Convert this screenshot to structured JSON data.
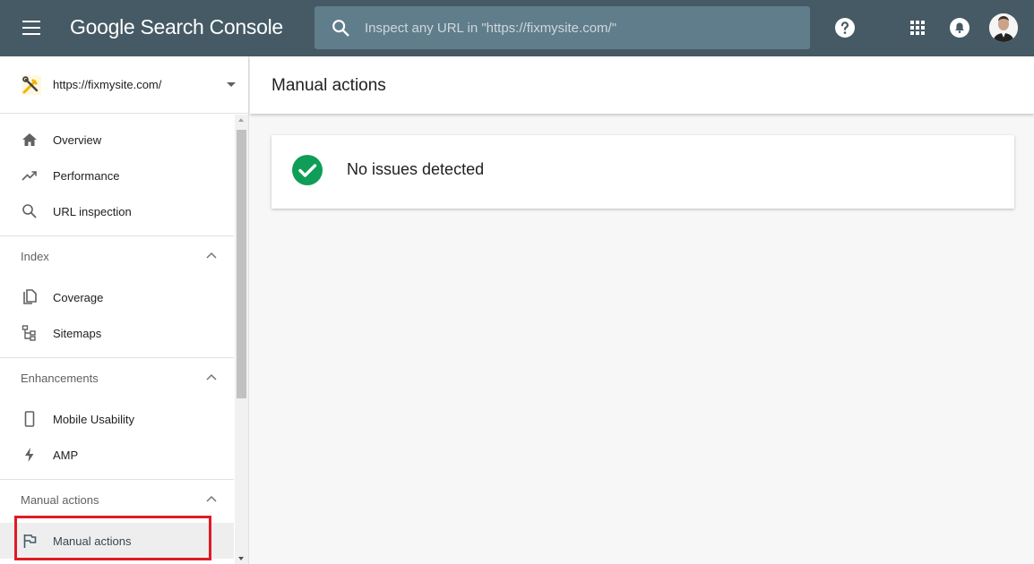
{
  "app": {
    "title": "Google Search Console"
  },
  "search": {
    "placeholder": "Inspect any URL in \"https://fixmysite.com/\""
  },
  "property": {
    "url": "https://fixmysite.com/"
  },
  "nav": {
    "overview": "Overview",
    "performance": "Performance",
    "url_inspection": "URL inspection",
    "index_section": "Index",
    "coverage": "Coverage",
    "sitemaps": "Sitemaps",
    "enhancements_section": "Enhancements",
    "mobile_usability": "Mobile Usability",
    "amp": "AMP",
    "manual_actions_section": "Manual actions",
    "manual_actions": "Manual actions"
  },
  "main": {
    "title": "Manual actions",
    "status_text": "No issues detected"
  },
  "icons": {
    "menu": "menu-icon",
    "search": "search-icon",
    "help": "help-icon",
    "apps": "apps-grid-icon",
    "notifications": "bell-icon",
    "status": "check-circle-icon"
  },
  "colors": {
    "topbar": "#455a64",
    "search_bg": "#607d8b",
    "success": "#0f9d58",
    "highlight": "#e01b24"
  }
}
